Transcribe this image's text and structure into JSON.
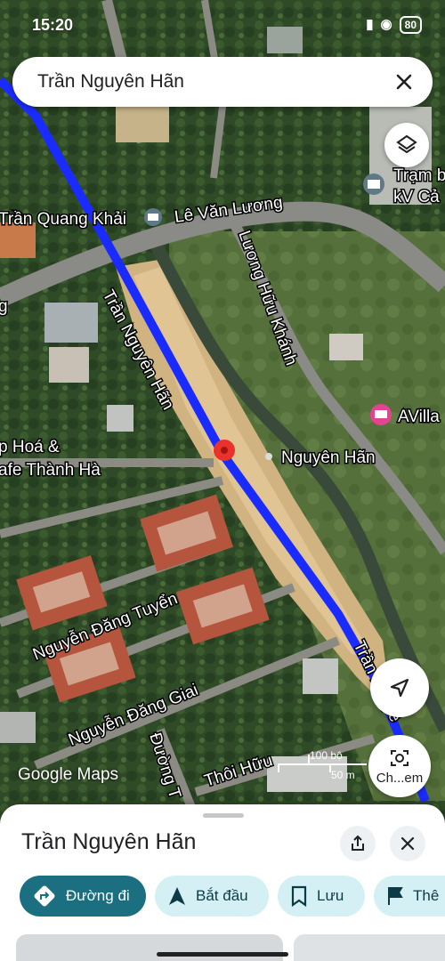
{
  "status_bar": {
    "time": "15:20",
    "battery": "80"
  },
  "search": {
    "query": "Trần Nguyên Hãn"
  },
  "map": {
    "labels": {
      "tran_nguyen_han_road": "Trần Nguyên Hãn",
      "tran_nguyen_han_road_lower": "Trần Nguyê",
      "tran_quang_khai": "Trần Quang Khải",
      "le_van_luong": "Lê Văn Lương",
      "luong_huu_khanh": "Lương Hữu Khánh",
      "nguyen_han_pin": "Nguyên Hãn",
      "tram_bien_ap_line1": "Trạm b",
      "tram_bien_ap_line2": "kV Cả",
      "avilla": "AVilla",
      "tap_hoa_line1": "p Hoá &",
      "tap_hoa_line2": "afe Thành Hà",
      "nguyen_dang_tuyen": "Nguyễn Đăng Tuyển",
      "nguyen_dang_giai": "Nguyễn Đăng Giai",
      "duong_t": "Đường T",
      "thoi_huu": "Thôi Hữu",
      "left_edge_g": "g"
    },
    "scale": {
      "imperial": "100 bộ",
      "metric": "50 m"
    },
    "attribution": "Google Maps",
    "route_color": "#1a2bff",
    "pin_color": "#e8322b"
  },
  "buttons": {
    "layers_icon": "layers-icon",
    "locate_icon": "navigation-arrow-icon",
    "lens_label": "Ch...em"
  },
  "sheet": {
    "title": "Trần Nguyên Hãn",
    "actions": [
      {
        "label": "Đường đi",
        "icon": "directions-icon"
      },
      {
        "label": "Bắt đầu",
        "icon": "navigate-arrow-icon"
      },
      {
        "label": "Lưu",
        "icon": "bookmark-icon"
      },
      {
        "label": "Thê",
        "icon": "flag-icon"
      }
    ]
  },
  "colors": {
    "primary_chip": "#1b6f80",
    "secondary_chip": "#d4f0f5"
  }
}
